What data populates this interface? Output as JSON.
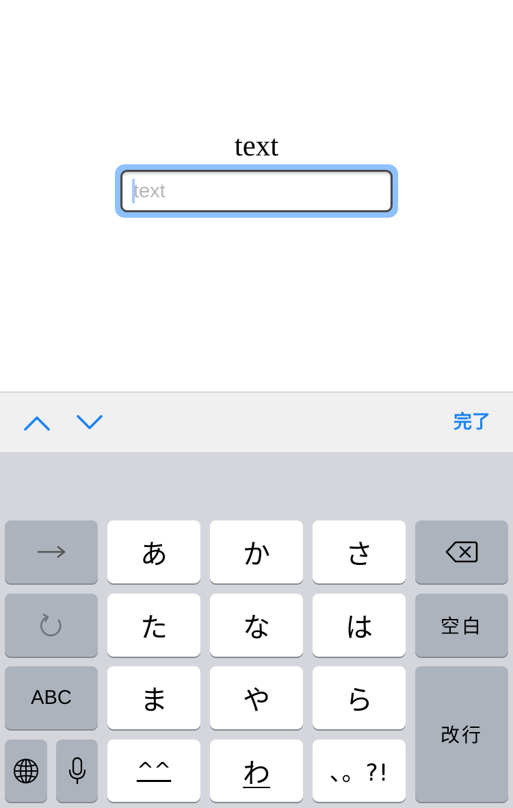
{
  "page": {
    "label": "text",
    "input": {
      "value": "",
      "placeholder": "text"
    }
  },
  "accessory_bar": {
    "prev_icon": "chevron-up-icon",
    "next_icon": "chevron-down-icon",
    "done_label": "完了",
    "accent_color": "#1a82f5"
  },
  "keyboard": {
    "rows": [
      [
        "→",
        "あ",
        "か",
        "さ",
        "⌫"
      ],
      [
        "↺",
        "た",
        "な",
        "は",
        "空白"
      ],
      [
        "ABC",
        "ま",
        "や",
        "ら",
        "改行"
      ],
      [
        "🌐",
        "🎤",
        "^^",
        "わ",
        "、。?!"
      ]
    ],
    "next_label": "→",
    "undo_icon": "undo-icon",
    "delete_icon": "delete-icon",
    "kana": {
      "a": "あ",
      "ka": "か",
      "sa": "さ",
      "ta": "た",
      "na": "な",
      "ha": "は",
      "ma": "ま",
      "ya": "や",
      "ra": "ら",
      "wa": "わ"
    },
    "space_label": "空白",
    "abc_label": "ABC",
    "return_label": "改行",
    "emoticon_label": "^^",
    "punct_label": "、。?!",
    "globe_icon": "globe-icon",
    "mic_icon": "microphone-icon",
    "light_key_color": "#ffffff",
    "dark_key_color": "#adb3bd",
    "background_color": "#d4d6dc"
  }
}
